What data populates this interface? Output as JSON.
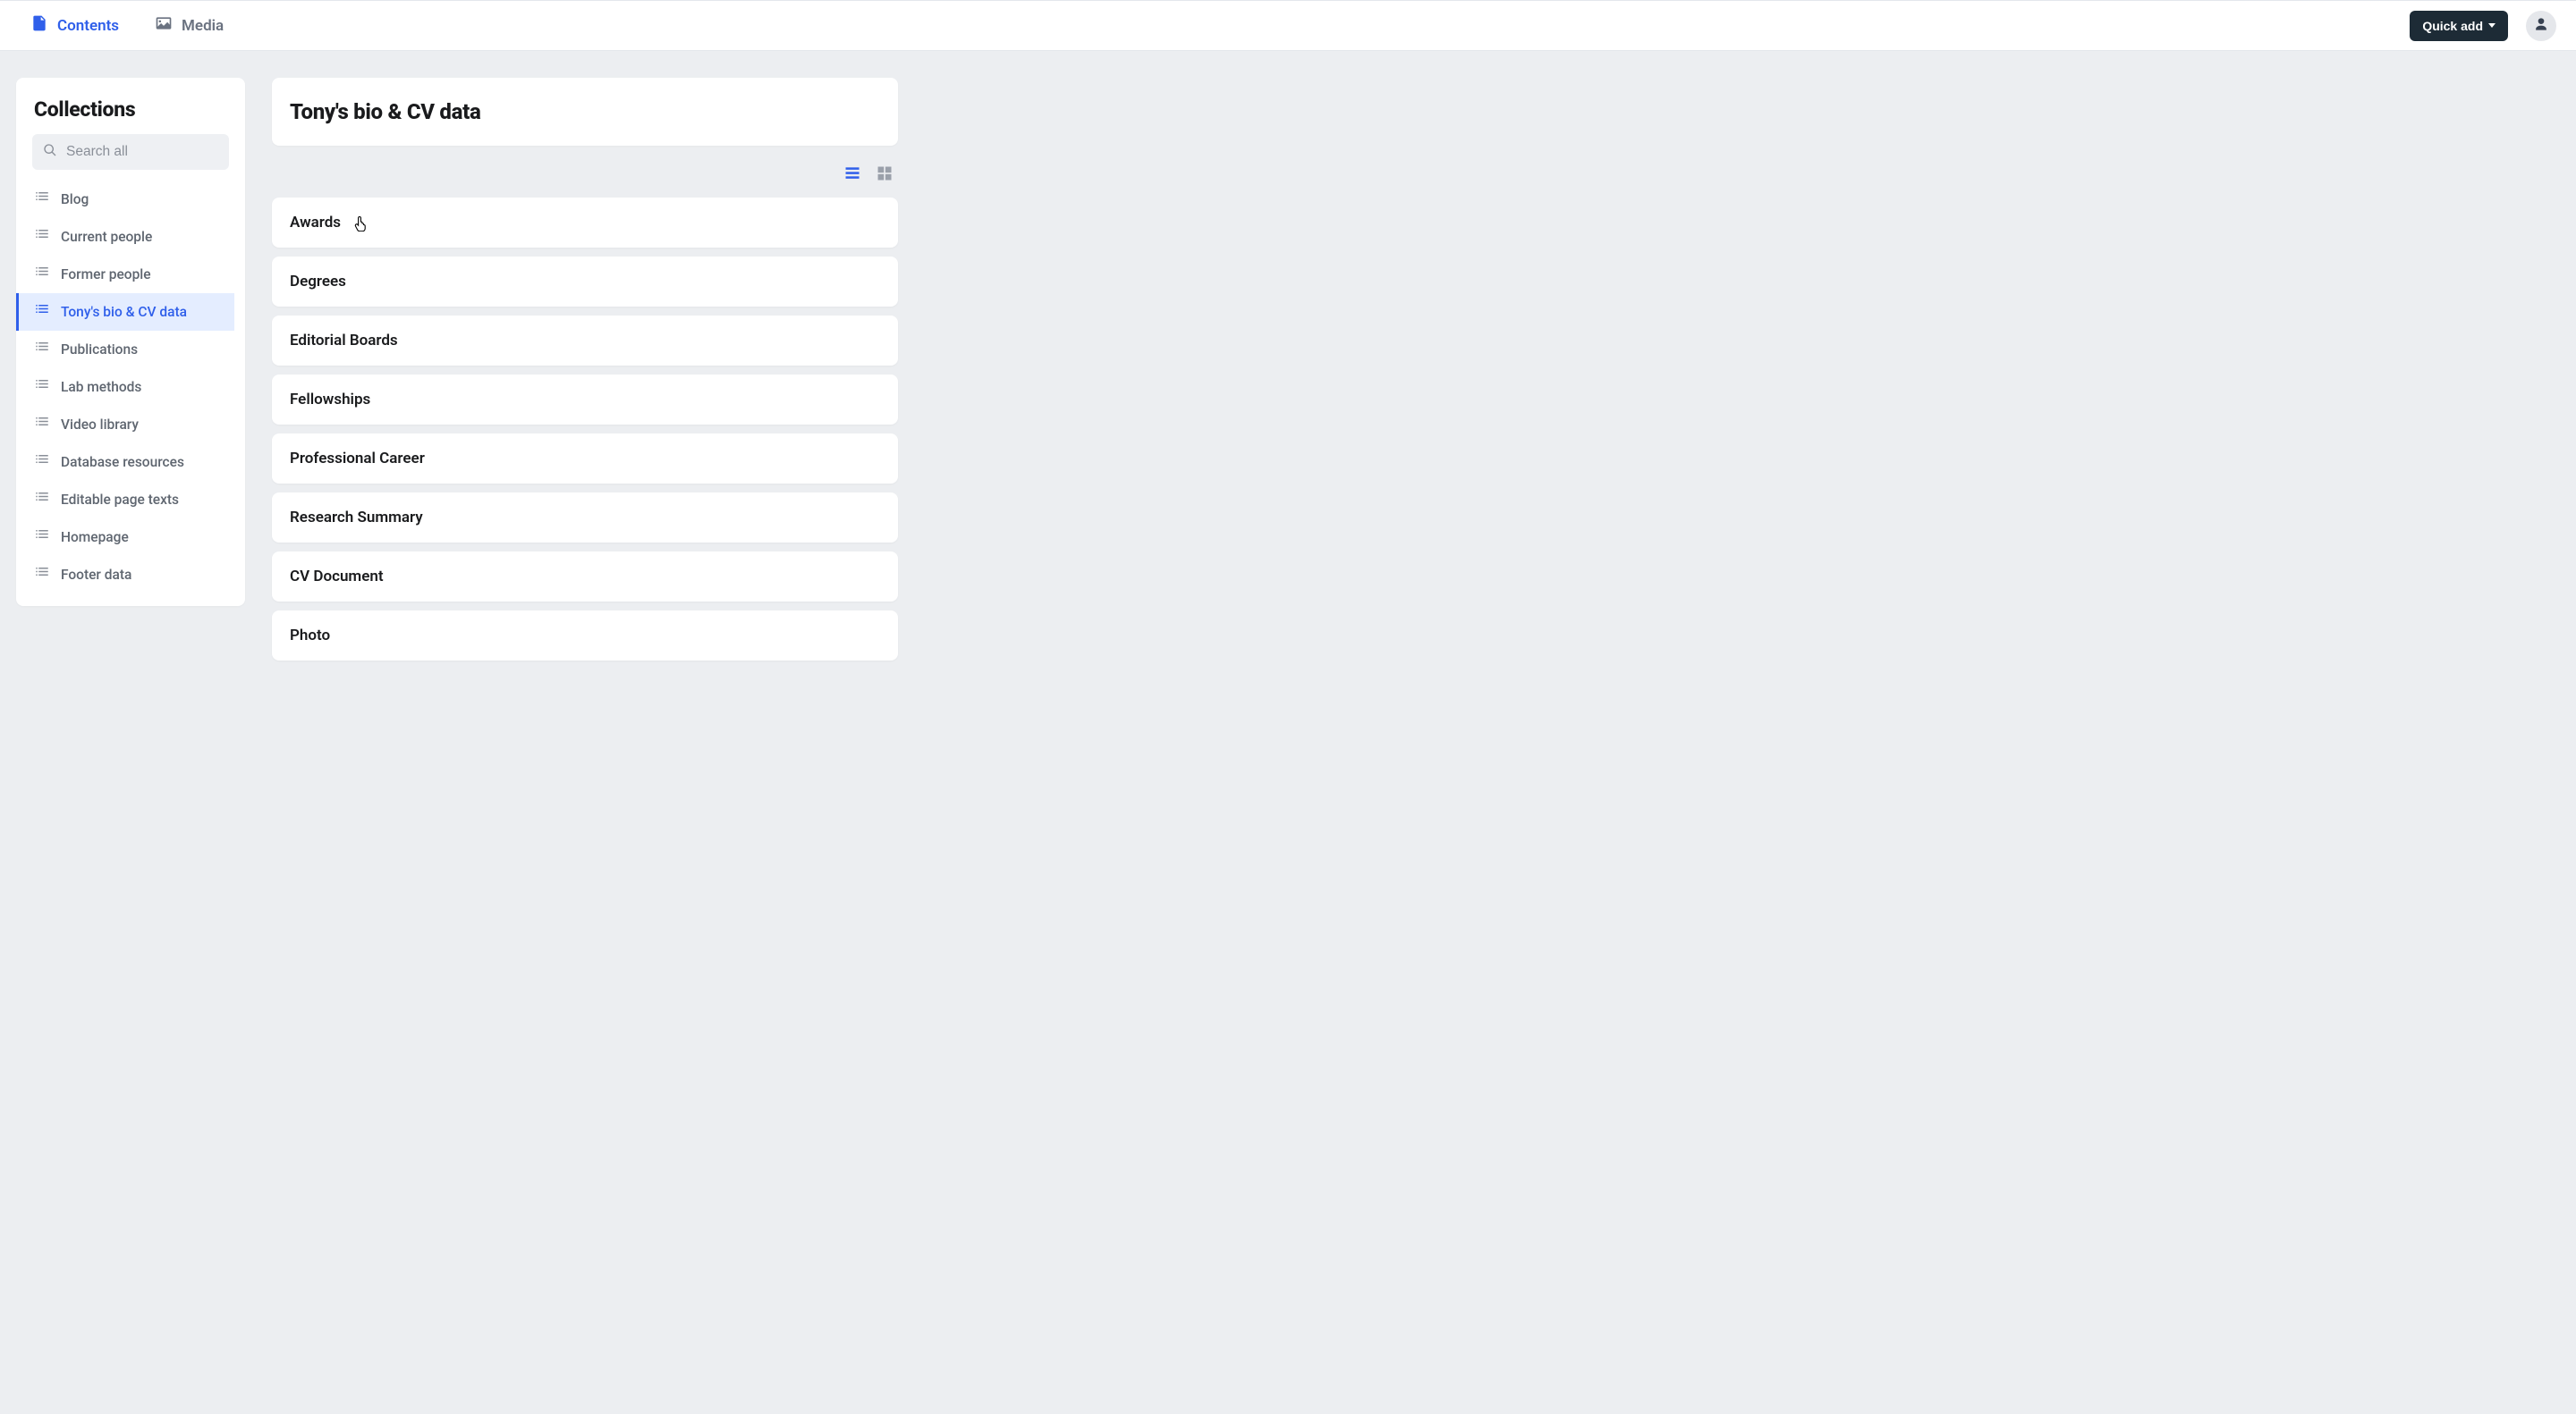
{
  "top_nav": {
    "contents_label": "Contents",
    "media_label": "Media",
    "quick_add_label": "Quick add"
  },
  "sidebar": {
    "title": "Collections",
    "search_placeholder": "Search all",
    "items": [
      {
        "label": "Blog",
        "active": false
      },
      {
        "label": "Current people",
        "active": false
      },
      {
        "label": "Former people",
        "active": false
      },
      {
        "label": "Tony's bio & CV data",
        "active": true
      },
      {
        "label": "Publications",
        "active": false
      },
      {
        "label": "Lab methods",
        "active": false
      },
      {
        "label": "Video library",
        "active": false
      },
      {
        "label": "Database resources",
        "active": false
      },
      {
        "label": "Editable page texts",
        "active": false
      },
      {
        "label": "Homepage",
        "active": false
      },
      {
        "label": "Footer data",
        "active": false
      }
    ]
  },
  "main": {
    "title": "Tony's bio & CV data",
    "entries": [
      {
        "label": "Awards"
      },
      {
        "label": "Degrees"
      },
      {
        "label": "Editorial Boards"
      },
      {
        "label": "Fellowships"
      },
      {
        "label": "Professional Career"
      },
      {
        "label": "Research Summary"
      },
      {
        "label": "CV Document"
      },
      {
        "label": "Photo"
      }
    ],
    "view_mode": "list"
  },
  "colors": {
    "accent": "#2f5fea",
    "bg": "#eceef1",
    "text_muted": "#6a7280"
  }
}
